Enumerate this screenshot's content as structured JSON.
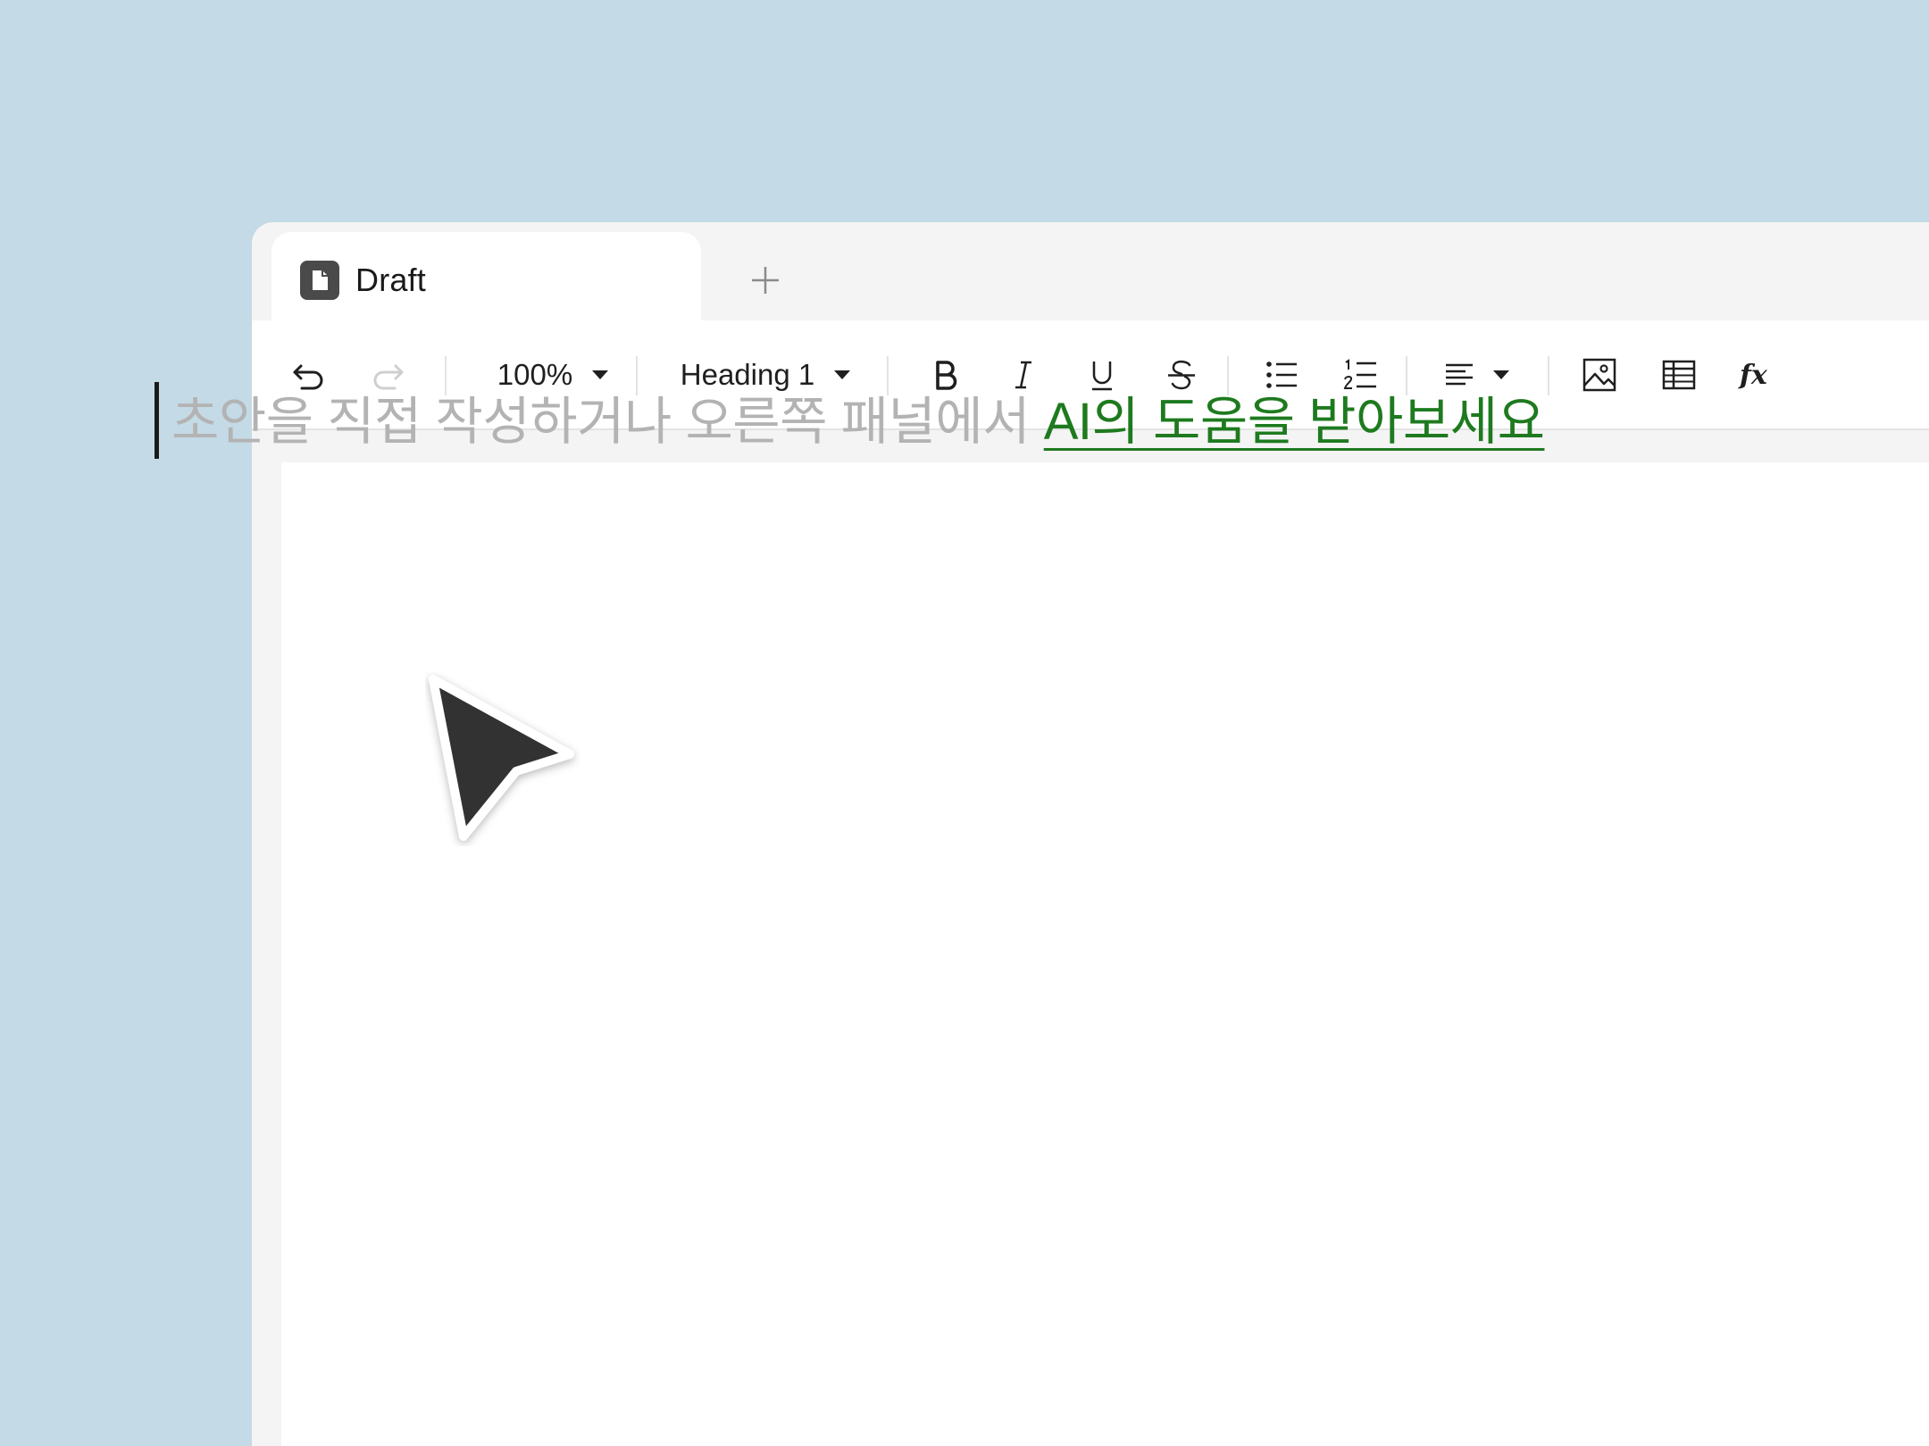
{
  "tabs": [
    {
      "title": "Draft",
      "icon": "document-icon",
      "active": true
    }
  ],
  "new_tab_icon": "plus-icon",
  "toolbar": {
    "undo_icon": "undo-icon",
    "redo_icon": "redo-icon",
    "zoom": "100%",
    "block_style": "Heading 1",
    "bold_icon": "bold-icon",
    "italic_icon": "italic-icon",
    "underline_icon": "underline-icon",
    "strikethrough_icon": "strikethrough-icon",
    "bulleted_list_icon": "bulleted-list-icon",
    "numbered_list_icon": "numbered-list-icon",
    "align_icon": "align-left-icon",
    "image_icon": "image-icon",
    "table_icon": "table-icon",
    "formula_icon": "fx-icon"
  },
  "editor": {
    "placeholder_text": "초안을 직접 작성하거나 오른쪽 패널에서 ",
    "ai_link_text": "AI의 도움을 받아보세요"
  },
  "colors": {
    "background": "#c4dae6",
    "window_chrome": "#f4f4f4",
    "placeholder": "#b3b3b3",
    "link": "#1e7a1e",
    "cursor_fill": "#333333"
  }
}
